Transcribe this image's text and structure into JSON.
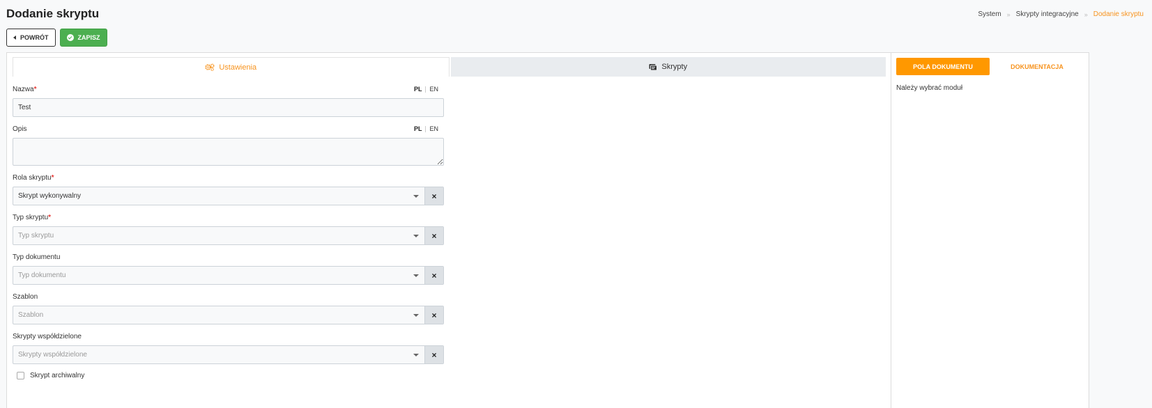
{
  "page": {
    "title": "Dodanie skryptu"
  },
  "breadcrumb": {
    "items": [
      "System",
      "Skrypty integracyjne",
      "Dodanie skryptu"
    ]
  },
  "toolbar": {
    "back_label": "POWRÓT",
    "save_label": "ZAPISZ"
  },
  "tabs": [
    {
      "label": "Ustawienia",
      "icon": "gears-icon",
      "active": true
    },
    {
      "label": "Skrypty",
      "icon": "script-icon",
      "active": false
    }
  ],
  "lang": {
    "pl": "PL",
    "en": "EN"
  },
  "form": {
    "name": {
      "label": "Nazwa",
      "required": "*",
      "value": "Test"
    },
    "description": {
      "label": "Opis",
      "value": ""
    },
    "role": {
      "label": "Rola skryptu",
      "required": "*",
      "value": "Skrypt wykonywalny"
    },
    "type": {
      "label": "Typ skryptu",
      "required": "*",
      "placeholder": "Typ skryptu"
    },
    "doc_type": {
      "label": "Typ dokumentu",
      "placeholder": "Typ dokumentu"
    },
    "template": {
      "label": "Szablon",
      "placeholder": "Szablon"
    },
    "shared": {
      "label": "Skrypty współdzielone",
      "placeholder": "Skrypty współdzielone"
    },
    "clear_glyph": "×",
    "archive": {
      "label": "Skrypt archiwalny",
      "checked": false
    }
  },
  "side": {
    "fields_button": "POLA DOKUMENTU",
    "docs_button": "DOKUMENTACJA",
    "note": "Należy wybrać moduł"
  },
  "colors": {
    "accent": "#f7931e",
    "success": "#4caf50",
    "required": "#e53935"
  }
}
